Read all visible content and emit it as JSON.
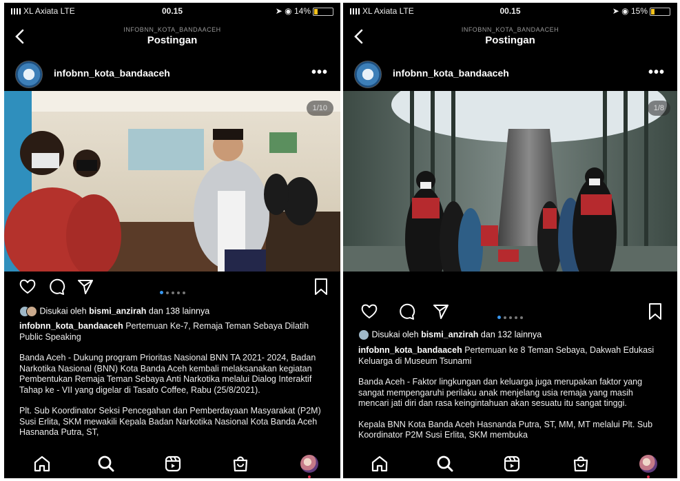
{
  "colors": {
    "background": "#000000",
    "text": "#ffffff",
    "dot_active": "#3797f0",
    "notification": "#e2334d"
  },
  "left": {
    "status": {
      "carrier": "XL Axiata  LTE",
      "time": "00.15",
      "battery": "14%"
    },
    "header": {
      "subtitle": "INFOBNN_KOTA_BANDAACEH",
      "title": "Postingan"
    },
    "account": "infobnn_kota_bandaaceh",
    "photo_counter": "1/10",
    "likes": {
      "prefix": "Disukai oleh",
      "user": "bismi_anzirah",
      "suffix": "dan 138 lainnya"
    },
    "caption": {
      "username": "infobnn_kota_bandaaceh",
      "headline": "Pertemuan Ke-7, Remaja Teman Sebaya Dilatih Public Speaking",
      "paragraph1": "Banda Aceh - Dukung program Prioritas Nasional BNN TA 2021- 2024, Badan Narkotika Nasional (BNN) Kota Banda Aceh kembali melaksanakan kegiatan Pembentukan Remaja Teman Sebaya Anti Narkotika melalui Dialog Interaktif Tahap ke - VII yang digelar di Tasafo Coffee, Rabu (25/8/2021).",
      "paragraph2": "Plt. Sub Koordinator Seksi Pencegahan dan Pemberdayaan Masyarakat (P2M) Susi Erlita, SKM mewakili Kepala Badan Narkotika Nasional Kota Banda Aceh Hasnanda Putra, ST,"
    }
  },
  "right": {
    "status": {
      "carrier": "XL Axiata  LTE",
      "time": "00.15",
      "battery": "15%"
    },
    "header": {
      "subtitle": "INFOBNN_KOTA_BANDAACEH",
      "title": "Postingan"
    },
    "account": "infobnn_kota_bandaaceh",
    "photo_counter": "1/8",
    "likes": {
      "prefix": "Disukai oleh",
      "user": "bismi_anzirah",
      "suffix": "dan 132 lainnya"
    },
    "caption": {
      "username": "infobnn_kota_bandaaceh",
      "headline": "Pertemuan ke 8 Teman Sebaya, Dakwah Edukasi Keluarga di Museum Tsunami",
      "paragraph1": "Banda Aceh - Faktor lingkungan dan keluarga juga merupakan faktor yang sangat mempengaruhi perilaku  anak menjelang usia remaja yang masih mencari jati diri dan rasa keingintahuan akan sesuatu itu sangat tinggi.",
      "paragraph2": "Kepala BNN Kota Banda Aceh Hasnanda Putra, ST, MM, MT melalui Plt. Sub Koordinator P2M Susi Erlita, SKM membuka"
    }
  },
  "icons": [
    "back-icon",
    "more-icon",
    "heart-icon",
    "comment-icon",
    "share-icon",
    "bookmark-icon",
    "home-icon",
    "search-icon",
    "reels-icon",
    "shop-icon",
    "profile-avatar"
  ]
}
